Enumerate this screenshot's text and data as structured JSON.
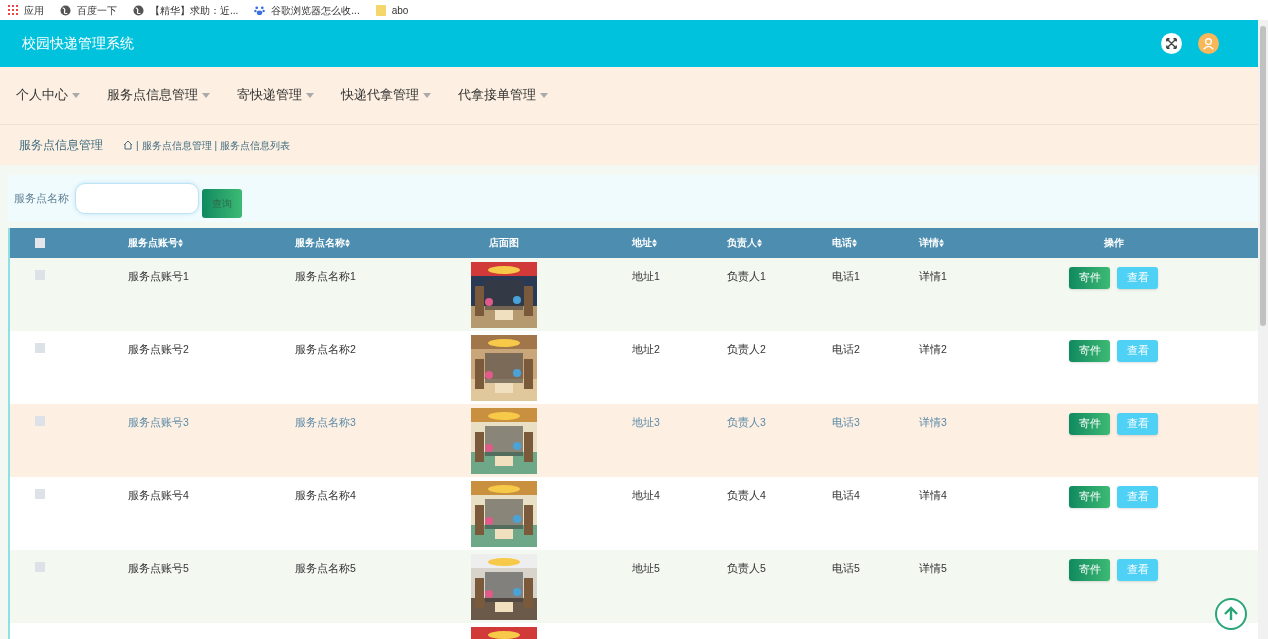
{
  "bookmarks": [
    {
      "kind": "apps",
      "label": "应用"
    },
    {
      "kind": "globe",
      "label": "百度一下"
    },
    {
      "kind": "globe",
      "label": "【精华】求助：近..."
    },
    {
      "kind": "paw",
      "label": "谷歌浏览器怎么收..."
    },
    {
      "kind": "folder",
      "label": "abo"
    }
  ],
  "header": {
    "title": "校园快递管理系统"
  },
  "nav": [
    "个人中心",
    "服务点信息管理",
    "寄快递管理",
    "快递代拿管理",
    "代拿接单管理"
  ],
  "breadcrumb": {
    "title": "服务点信息管理",
    "separator": "|",
    "items": [
      "服务点信息管理",
      "服务点信息列表"
    ]
  },
  "search": {
    "label": "服务点名称",
    "button": "查询"
  },
  "table": {
    "select_all_checked": false,
    "columns": [
      {
        "label": "服务点账号",
        "sortable": true
      },
      {
        "label": "服务点名称",
        "sortable": true
      },
      {
        "label": "店面图",
        "sortable": false
      },
      {
        "label": "地址",
        "sortable": true
      },
      {
        "label": "负责人",
        "sortable": true
      },
      {
        "label": "电话",
        "sortable": true
      },
      {
        "label": "详情",
        "sortable": true
      },
      {
        "label": "操作",
        "sortable": false
      }
    ],
    "rows": [
      {
        "checked": false,
        "hovered": false,
        "cells": [
          {
            "kind": "text",
            "text": "服务点账号1"
          },
          {
            "kind": "text",
            "text": "服务点名称1"
          },
          {
            "kind": "picture"
          },
          {
            "kind": "text",
            "text": "地址1"
          },
          {
            "kind": "text",
            "text": "负责人1"
          },
          {
            "kind": "text",
            "text": "电话1"
          },
          {
            "kind": "text",
            "text": "详情1"
          },
          {
            "kind": "actions",
            "actions": [
              "寄件",
              "查看"
            ]
          }
        ]
      },
      {
        "checked": false,
        "hovered": false,
        "cells": [
          {
            "kind": "text",
            "text": "服务点账号2"
          },
          {
            "kind": "text",
            "text": "服务点名称2"
          },
          {
            "kind": "picture"
          },
          {
            "kind": "text",
            "text": "地址2"
          },
          {
            "kind": "text",
            "text": "负责人2"
          },
          {
            "kind": "text",
            "text": "电话2"
          },
          {
            "kind": "text",
            "text": "详情2"
          },
          {
            "kind": "actions",
            "actions": [
              "寄件",
              "查看"
            ]
          }
        ]
      },
      {
        "checked": false,
        "hovered": true,
        "cells": [
          {
            "kind": "text",
            "text": "服务点账号3"
          },
          {
            "kind": "text",
            "text": "服务点名称3"
          },
          {
            "kind": "picture"
          },
          {
            "kind": "text",
            "text": "地址3"
          },
          {
            "kind": "text",
            "text": "负责人3"
          },
          {
            "kind": "text",
            "text": "电话3"
          },
          {
            "kind": "text",
            "text": "详情3"
          },
          {
            "kind": "actions",
            "actions": [
              "寄件",
              "查看"
            ]
          }
        ]
      },
      {
        "checked": false,
        "hovered": false,
        "cells": [
          {
            "kind": "text",
            "text": "服务点账号4"
          },
          {
            "kind": "text",
            "text": "服务点名称4"
          },
          {
            "kind": "picture"
          },
          {
            "kind": "text",
            "text": "地址4"
          },
          {
            "kind": "text",
            "text": "负责人4"
          },
          {
            "kind": "text",
            "text": "电话4"
          },
          {
            "kind": "text",
            "text": "详情4"
          },
          {
            "kind": "actions",
            "actions": [
              "寄件",
              "查看"
            ]
          }
        ]
      },
      {
        "checked": false,
        "hovered": false,
        "cells": [
          {
            "kind": "text",
            "text": "服务点账号5"
          },
          {
            "kind": "text",
            "text": "服务点名称5"
          },
          {
            "kind": "picture"
          },
          {
            "kind": "text",
            "text": "地址5"
          },
          {
            "kind": "text",
            "text": "负责人5"
          },
          {
            "kind": "text",
            "text": "电话5"
          },
          {
            "kind": "text",
            "text": "详情5"
          },
          {
            "kind": "actions",
            "actions": [
              "寄件",
              "查看"
            ]
          }
        ]
      }
    ]
  }
}
